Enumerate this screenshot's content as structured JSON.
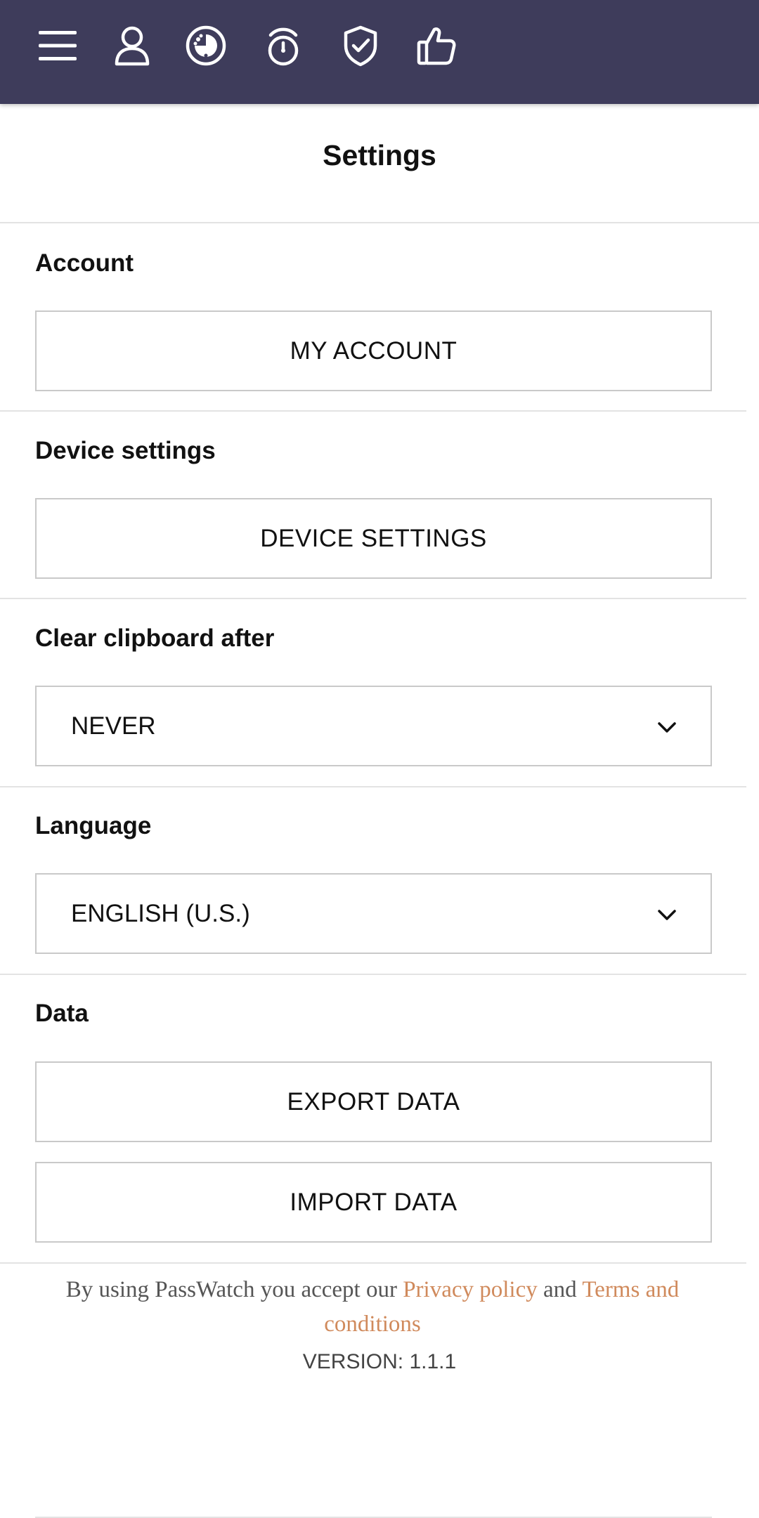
{
  "nav": {
    "icons": [
      "menu-icon",
      "user-icon",
      "dashboard-icon",
      "timer-icon",
      "shield-check-icon",
      "thumbs-up-icon"
    ],
    "bar_color": "#3e3c5b"
  },
  "page": {
    "title": "Settings"
  },
  "sections": {
    "account": {
      "label": "Account",
      "button": "MY ACCOUNT"
    },
    "device": {
      "label": "Device settings",
      "button": "DEVICE SETTINGS"
    },
    "clipboard": {
      "label": "Clear clipboard after",
      "selected": "NEVER"
    },
    "language": {
      "label": "Language",
      "selected": "ENGLISH (U.S.)"
    },
    "data": {
      "label": "Data",
      "export_button": "EXPORT DATA",
      "import_button": "IMPORT DATA"
    }
  },
  "footer": {
    "prefix": "By using PassWatch you accept our ",
    "privacy_link": "Privacy policy",
    "and": " and ",
    "terms_link": "Terms and conditions",
    "version": "VERSION: 1.1.1",
    "link_color": "#d08a5c"
  }
}
